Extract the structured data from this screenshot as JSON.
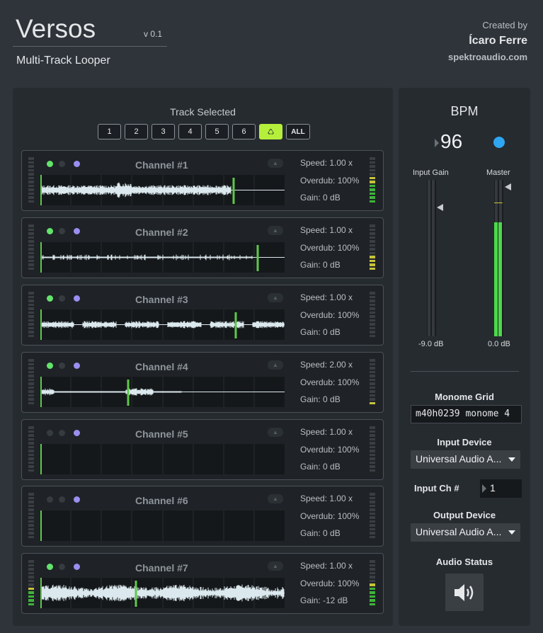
{
  "header": {
    "app_title": "Versos",
    "version": "v 0.1",
    "subtitle": "Multi-Track Looper",
    "created_by_label": "Created by",
    "author": "Ícaro Ferre",
    "website": "spektroaudio.com"
  },
  "tracks": {
    "label": "Track Selected",
    "buttons": [
      "1",
      "2",
      "3",
      "4",
      "5",
      "6",
      "♺",
      "ALL"
    ],
    "selected": "♺"
  },
  "channels": [
    {
      "name": "Channel #1",
      "speed": "Speed: 1.00 x",
      "overdub": "Overdub: 100%",
      "gain": "Gain: 0 dB",
      "play_position": 0.79,
      "has_audio": true,
      "active": true
    },
    {
      "name": "Channel #2",
      "speed": "Speed: 1.00 x",
      "overdub": "Overdub: 100%",
      "gain": "Gain: 0 dB",
      "play_position": 0.89,
      "has_audio": true,
      "active": true
    },
    {
      "name": "Channel #3",
      "speed": "Speed: 1.00 x",
      "overdub": "Overdub: 100%",
      "gain": "Gain: 0 dB",
      "play_position": 0.8,
      "has_audio": true,
      "active": true
    },
    {
      "name": "Channel #4",
      "speed": "Speed: 2.00 x",
      "overdub": "Overdub: 100%",
      "gain": "Gain: 0 dB",
      "play_position": 0.36,
      "has_audio": true,
      "active": true
    },
    {
      "name": "Channel #5",
      "speed": "Speed: 1.00 x",
      "overdub": "Overdub: 100%",
      "gain": "Gain: 0 dB",
      "play_position": 0.0,
      "has_audio": false,
      "active": false
    },
    {
      "name": "Channel #6",
      "speed": "Speed: 1.00 x",
      "overdub": "Overdub: 100%",
      "gain": "Gain: 0 dB",
      "play_position": 0.0,
      "has_audio": false,
      "active": false
    },
    {
      "name": "Channel #7",
      "speed": "Speed: 1.00 x",
      "overdub": "Overdub: 100%",
      "gain": "Gain: -12 dB",
      "play_position": 0.39,
      "has_audio": true,
      "active": true
    }
  ],
  "right": {
    "bpm_label": "BPM",
    "bpm_value": "96",
    "input_gain_label": "Input Gain",
    "master_label": "Master",
    "input_gain_value": "-9.0 dB",
    "master_value": "0.0 dB",
    "master_level": 0.73,
    "monome_label": "Monome Grid",
    "monome_value": "m40h0239 monome 4",
    "input_device_label": "Input Device",
    "input_device_value": "Universal Audio A...",
    "input_ch_label": "Input Ch #",
    "input_ch_value": "1",
    "output_device_label": "Output Device",
    "output_device_value": "Universal Audio A...",
    "audio_status_label": "Audio Status"
  },
  "colors": {
    "accent": "#b5ef3b",
    "meter_green": "#4cd94a",
    "bpm_led": "#2ea6f2",
    "playhead": "#5ec84a",
    "waveform": "#dbe9ee"
  }
}
